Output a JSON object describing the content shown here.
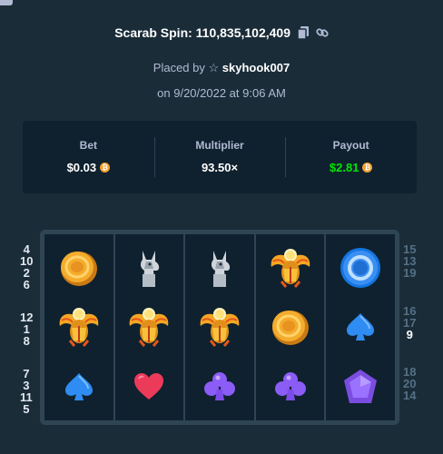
{
  "header": {
    "title": "Scarab Spin: 110,835,102,409",
    "placed_prefix": "Placed by",
    "username": "skyhook007",
    "date": "on 9/20/2022 at 9:06 AM"
  },
  "stats": {
    "bet_label": "Bet",
    "bet_value": "$0.03",
    "multiplier_label": "Multiplier",
    "multiplier_value": "93.50×",
    "payout_label": "Payout",
    "payout_value": "$2.81"
  },
  "colors": {
    "background": "#1a2c38",
    "panel": "#0f212e",
    "payout_green": "#00e701",
    "coin_orange": "#f3a12c"
  },
  "board": {
    "columns": [
      [
        "gold-coin",
        "scarab",
        "blue-spade"
      ],
      [
        "silver-jackal",
        "scarab",
        "red-heart"
      ],
      [
        "silver-jackal",
        "scarab",
        "purple-club"
      ],
      [
        "scarab",
        "gold-coin",
        "purple-club"
      ],
      [
        "blue-ring",
        "blue-spade",
        "purple-gem"
      ]
    ]
  },
  "paylines": {
    "left": [
      [
        "4",
        "10",
        "2",
        "6"
      ],
      [
        "12",
        "1",
        "8"
      ],
      [
        "7",
        "3",
        "11",
        "5"
      ]
    ],
    "right": [
      [
        "15",
        "13",
        "19"
      ],
      [
        "16",
        "17",
        "9"
      ],
      [
        "18",
        "20",
        "14"
      ]
    ]
  }
}
